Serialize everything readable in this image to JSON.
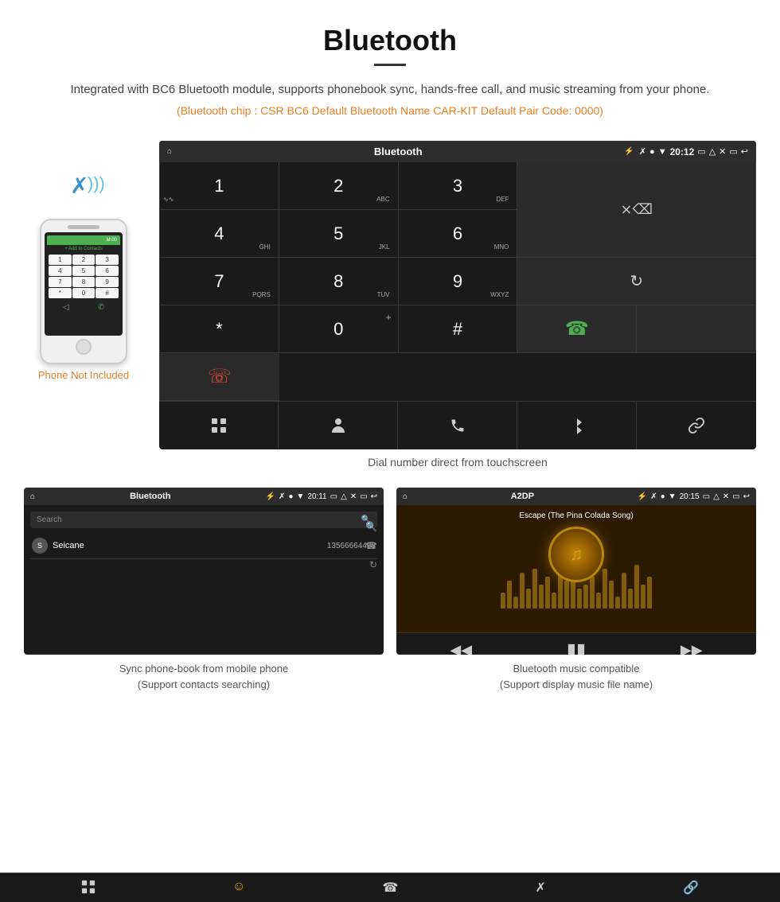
{
  "header": {
    "title": "Bluetooth",
    "description": "Integrated with BC6 Bluetooth module, supports phonebook sync, hands-free call, and music streaming from your phone.",
    "specs": "(Bluetooth chip : CSR BC6    Default Bluetooth Name CAR-KIT    Default Pair Code: 0000)"
  },
  "phone_mockup": {
    "not_included_label": "Phone Not Included",
    "add_contact": "+ Add to Contacts",
    "keys": [
      "1",
      "2",
      "3",
      "4",
      "5",
      "6",
      "7",
      "8",
      "9",
      "*",
      "0",
      "#"
    ],
    "bottom_buttons": [
      "⊕",
      "✆"
    ]
  },
  "dial_screen": {
    "status_bar": {
      "home_icon": "⌂",
      "title": "Bluetooth",
      "usb_icon": "⚡",
      "bluetooth_icon": "✱",
      "location_icon": "⊙",
      "signal_icon": "▼",
      "time": "20:12",
      "camera_icon": "◫",
      "volume_icon": "◁",
      "close_icon": "✕",
      "layout_icon": "▭",
      "back_icon": "↩"
    },
    "keys": [
      {
        "number": "1",
        "sub": "∽∽",
        "type": "key"
      },
      {
        "number": "2",
        "sub": "ABC",
        "type": "key"
      },
      {
        "number": "3",
        "sub": "DEF",
        "type": "key"
      },
      {
        "type": "display",
        "span": 2
      },
      {
        "number": "4",
        "sub": "GHI",
        "type": "key"
      },
      {
        "number": "5",
        "sub": "JKL",
        "type": "key"
      },
      {
        "number": "6",
        "sub": "MNO",
        "type": "key"
      },
      {
        "type": "empty",
        "span": 2
      },
      {
        "number": "7",
        "sub": "PQRS",
        "type": "key"
      },
      {
        "number": "8",
        "sub": "TUV",
        "type": "key"
      },
      {
        "number": "9",
        "sub": "WXYZ",
        "type": "key"
      },
      {
        "type": "refresh",
        "span": 2
      },
      {
        "number": "*",
        "type": "key"
      },
      {
        "number": "0",
        "sub": "+",
        "type": "key"
      },
      {
        "number": "#",
        "type": "key"
      },
      {
        "type": "call_green"
      },
      {
        "type": "empty"
      },
      {
        "type": "call_red"
      }
    ],
    "actions": [
      "grid",
      "person",
      "phone",
      "bluetooth",
      "link"
    ],
    "caption": "Dial number direct from touchscreen"
  },
  "phonebook_screen": {
    "status_bar_title": "Bluetooth",
    "search_placeholder": "Search",
    "contact": {
      "letter": "S",
      "name": "Seicane",
      "number": "13566664466"
    },
    "caption_line1": "Sync phone-book from mobile phone",
    "caption_line2": "(Support contacts searching)"
  },
  "music_screen": {
    "status_bar_title": "A2DP",
    "song_title": "Escape (The Pina Colada Song)",
    "caption_line1": "Bluetooth music compatible",
    "caption_line2": "(Support display music file name)"
  },
  "colors": {
    "accent_orange": "#e67e22",
    "dark_bg": "#1a1a1a",
    "call_green": "#4CAF50",
    "call_red": "#e74c3c",
    "gold": "#d4a017"
  }
}
